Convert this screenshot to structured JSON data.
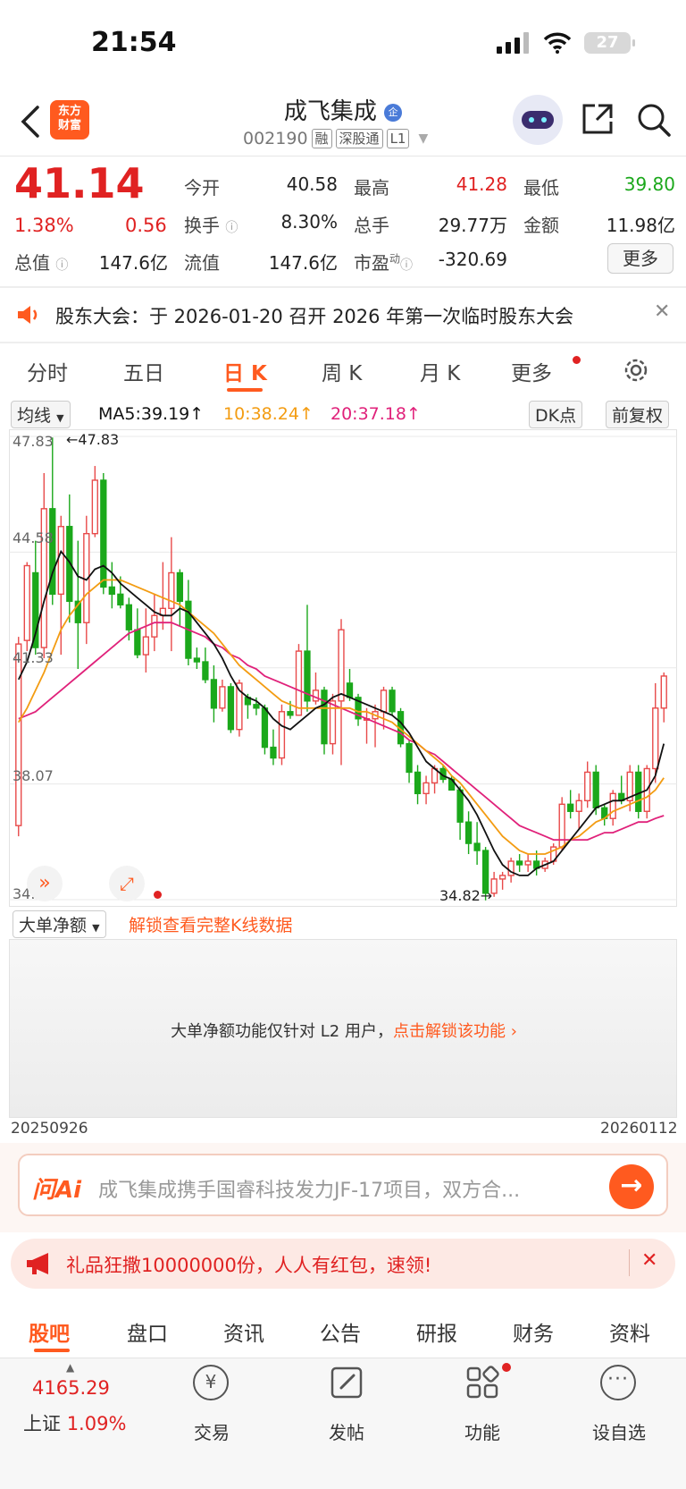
{
  "status_bar": {
    "time": "21:54",
    "battery": "27"
  },
  "header": {
    "logo_line1": "东方",
    "logo_line2": "财富",
    "stock_name": "成飞集成",
    "name_badge": "企",
    "stock_code": "002190",
    "tags": [
      "融",
      "深股通",
      "L1"
    ]
  },
  "quote": {
    "price": "41.14",
    "change_pct": "1.38%",
    "change_amt": "0.56",
    "open_label": "今开",
    "open": "40.58",
    "high_label": "最高",
    "high": "41.28",
    "low_label": "最低",
    "low": "39.80",
    "turnover_label": "换手",
    "turnover": "8.30%",
    "volume_label": "总手",
    "volume": "29.77万",
    "amount_label": "金额",
    "amount": "11.98亿",
    "mcap_label": "总值",
    "mcap": "147.6亿",
    "float_label": "流值",
    "float": "147.6亿",
    "pe_label": "市盈",
    "pe_sup": "动",
    "pe": "-320.69",
    "more_label": "更多"
  },
  "notice": {
    "text": "股东大会：于 2026-01-20 召开 2026 年第一次临时股东大会"
  },
  "chart_tabs": [
    "分时",
    "五日",
    "日 K",
    "周 K",
    "月 K",
    "更多"
  ],
  "active_chart_tab": "日 K",
  "ma_bar": {
    "indicator": "均线",
    "ma5": "MA5:39.19↑",
    "ma10": "10:38.24↑",
    "ma20": "20:37.18↑",
    "dk_label": "DK点",
    "adjust_label": "前复权",
    "ma5_color": "#111111",
    "ma10_color": "#f39c12",
    "ma20_color": "#e0217a"
  },
  "chart_data": {
    "type": "candlestick",
    "y_ticks": [
      "47.83",
      "44.58",
      "41.33",
      "38.07",
      "34.82"
    ],
    "ylim": [
      34.82,
      47.83
    ],
    "high_marker": "←47.83",
    "low_marker": "34.82→",
    "x_start": "20250926",
    "x_end": "20260112",
    "candles": [
      [
        36.9,
        42.2,
        36.6,
        42.0
      ],
      [
        42.1,
        44.3,
        41.8,
        44.2
      ],
      [
        44.0,
        44.9,
        41.7,
        41.9
      ],
      [
        41.9,
        46.8,
        41.6,
        45.8
      ],
      [
        45.8,
        47.8,
        43.1,
        43.4
      ],
      [
        43.4,
        45.6,
        41.7,
        45.3
      ],
      [
        45.3,
        46.2,
        42.6,
        43.2
      ],
      [
        43.2,
        44.9,
        41.3,
        42.6
      ],
      [
        42.6,
        45.6,
        42.0,
        45.1
      ],
      [
        45.1,
        47.0,
        45.0,
        46.6
      ],
      [
        46.6,
        46.8,
        43.4,
        43.6
      ],
      [
        43.6,
        44.3,
        43.0,
        43.4
      ],
      [
        43.4,
        43.9,
        43.0,
        43.1
      ],
      [
        43.1,
        43.3,
        42.1,
        42.4
      ],
      [
        42.4,
        43.0,
        41.6,
        41.7
      ],
      [
        41.7,
        43.0,
        41.2,
        42.2
      ],
      [
        42.2,
        43.4,
        41.8,
        42.8
      ],
      [
        42.8,
        44.3,
        42.4,
        43.0
      ],
      [
        43.0,
        45.0,
        41.8,
        44.0
      ],
      [
        44.0,
        44.1,
        42.5,
        43.2
      ],
      [
        43.2,
        43.8,
        41.4,
        41.6
      ],
      [
        41.6,
        41.9,
        41.3,
        41.5
      ],
      [
        41.5,
        41.9,
        40.9,
        41.0
      ],
      [
        41.0,
        41.4,
        39.8,
        40.2
      ],
      [
        40.2,
        41.0,
        40.1,
        40.8
      ],
      [
        40.8,
        40.9,
        39.5,
        39.6
      ],
      [
        39.6,
        41.0,
        39.4,
        40.9
      ],
      [
        40.5,
        40.6,
        39.9,
        40.3
      ],
      [
        40.3,
        40.5,
        40.0,
        40.2
      ],
      [
        40.2,
        40.3,
        38.9,
        39.1
      ],
      [
        39.1,
        39.6,
        38.6,
        38.8
      ],
      [
        38.8,
        40.3,
        38.6,
        40.1
      ],
      [
        40.1,
        40.4,
        39.9,
        40.0
      ],
      [
        40.0,
        42.0,
        40.0,
        41.8
      ],
      [
        41.8,
        43.1,
        40.1,
        40.4
      ],
      [
        40.4,
        41.2,
        40.3,
        40.7
      ],
      [
        40.7,
        40.8,
        38.9,
        39.2
      ],
      [
        39.2,
        40.6,
        38.9,
        40.4
      ],
      [
        40.4,
        42.7,
        38.6,
        42.4
      ],
      [
        40.9,
        41.3,
        40.4,
        40.5
      ],
      [
        40.5,
        40.6,
        39.7,
        39.9
      ],
      [
        39.9,
        40.2,
        39.2,
        39.9
      ],
      [
        39.9,
        40.3,
        39.1,
        40.1
      ],
      [
        40.1,
        40.8,
        39.6,
        40.7
      ],
      [
        40.7,
        40.8,
        40.0,
        40.1
      ],
      [
        40.1,
        40.2,
        39.1,
        39.2
      ],
      [
        39.2,
        39.3,
        38.1,
        38.4
      ],
      [
        38.4,
        38.6,
        37.5,
        37.8
      ],
      [
        37.8,
        38.3,
        37.5,
        38.1
      ],
      [
        38.1,
        38.6,
        37.8,
        38.5
      ],
      [
        38.5,
        38.6,
        38.1,
        38.2
      ],
      [
        38.2,
        38.3,
        37.9,
        37.9
      ],
      [
        37.9,
        38.0,
        36.5,
        37.0
      ],
      [
        37.0,
        37.3,
        36.1,
        36.4
      ],
      [
        36.4,
        37.0,
        35.8,
        36.2
      ],
      [
        36.2,
        36.3,
        34.8,
        35.0
      ],
      [
        35.0,
        35.6,
        34.9,
        35.4
      ],
      [
        35.4,
        35.6,
        35.1,
        35.5
      ],
      [
        35.5,
        36.0,
        35.3,
        35.9
      ],
      [
        35.9,
        36.1,
        35.6,
        35.8
      ],
      [
        35.8,
        36.1,
        35.6,
        35.9
      ],
      [
        35.9,
        36.2,
        35.5,
        35.7
      ],
      [
        35.7,
        36.0,
        35.6,
        35.9
      ],
      [
        35.9,
        36.4,
        35.8,
        36.3
      ],
      [
        36.3,
        37.7,
        36.2,
        37.5
      ],
      [
        37.5,
        37.9,
        37.1,
        37.3
      ],
      [
        37.3,
        37.8,
        36.8,
        37.6
      ],
      [
        37.6,
        38.7,
        37.4,
        38.4
      ],
      [
        38.4,
        38.6,
        37.2,
        37.4
      ],
      [
        37.4,
        37.5,
        36.9,
        37.1
      ],
      [
        37.1,
        37.9,
        36.9,
        37.8
      ],
      [
        37.8,
        38.3,
        37.5,
        37.6
      ],
      [
        37.6,
        38.6,
        37.3,
        38.4
      ],
      [
        38.4,
        38.6,
        37.1,
        37.3
      ],
      [
        37.3,
        38.6,
        37.1,
        38.5
      ],
      [
        38.5,
        40.9,
        38.1,
        40.2
      ],
      [
        40.2,
        41.2,
        39.8,
        41.1
      ]
    ],
    "ma5": [
      41.0,
      41.5,
      42.3,
      43.2,
      44.0,
      44.6,
      44.3,
      43.9,
      43.8,
      44.1,
      44.2,
      44.0,
      43.7,
      43.5,
      43.3,
      43.1,
      42.9,
      42.8,
      42.8,
      43.0,
      42.9,
      42.6,
      42.3,
      42.0,
      41.6,
      41.1,
      40.7,
      40.5,
      40.4,
      40.2,
      39.9,
      39.7,
      39.6,
      39.8,
      40.0,
      40.2,
      40.3,
      40.5,
      40.6,
      40.5,
      40.4,
      40.3,
      40.2,
      40.1,
      40.0,
      39.8,
      39.5,
      39.1,
      38.7,
      38.5,
      38.3,
      38.2,
      37.9,
      37.6,
      37.2,
      36.7,
      36.2,
      35.8,
      35.6,
      35.5,
      35.5,
      35.7,
      35.8,
      35.9,
      36.2,
      36.5,
      36.8,
      37.1,
      37.4,
      37.5,
      37.6,
      37.6,
      37.7,
      37.8,
      37.9,
      38.3,
      39.2
    ],
    "ma10": [
      39.8,
      40.2,
      40.7,
      41.2,
      41.8,
      42.4,
      42.8,
      43.1,
      43.4,
      43.6,
      43.8,
      43.8,
      43.8,
      43.7,
      43.6,
      43.5,
      43.4,
      43.3,
      43.2,
      43.1,
      42.9,
      42.7,
      42.5,
      42.3,
      42.0,
      41.7,
      41.4,
      41.2,
      41.0,
      40.8,
      40.6,
      40.4,
      40.3,
      40.2,
      40.2,
      40.2,
      40.2,
      40.2,
      40.2,
      40.2,
      40.1,
      40.1,
      40.0,
      39.9,
      39.8,
      39.6,
      39.4,
      39.2,
      39.0,
      38.8,
      38.6,
      38.3,
      38.1,
      37.8,
      37.5,
      37.2,
      36.9,
      36.6,
      36.4,
      36.2,
      36.1,
      36.1,
      36.1,
      36.2,
      36.3,
      36.5,
      36.6,
      36.8,
      37.0,
      37.1,
      37.3,
      37.4,
      37.5,
      37.6,
      37.7,
      37.9,
      38.24
    ],
    "ma20": [
      39.9,
      40.0,
      40.1,
      40.3,
      40.5,
      40.7,
      40.9,
      41.1,
      41.3,
      41.5,
      41.7,
      41.9,
      42.1,
      42.3,
      42.4,
      42.5,
      42.6,
      42.6,
      42.6,
      42.5,
      42.4,
      42.3,
      42.2,
      42.0,
      41.9,
      41.7,
      41.6,
      41.4,
      41.3,
      41.1,
      41.0,
      40.9,
      40.8,
      40.7,
      40.6,
      40.5,
      40.4,
      40.3,
      40.2,
      40.1,
      40.0,
      39.9,
      39.8,
      39.7,
      39.6,
      39.5,
      39.3,
      39.2,
      39.0,
      38.9,
      38.7,
      38.5,
      38.3,
      38.1,
      37.9,
      37.7,
      37.5,
      37.3,
      37.1,
      36.9,
      36.8,
      36.7,
      36.6,
      36.5,
      36.5,
      36.5,
      36.5,
      36.5,
      36.6,
      36.7,
      36.7,
      36.8,
      36.9,
      37.0,
      37.0,
      37.1,
      37.18
    ]
  },
  "volume_panel": {
    "selector": "大单净额",
    "unlock_link": "解锁查看完整K线数据",
    "l2_text": "大单净额功能仅针对 L2 用户，",
    "l2_link": "点击解锁该功能",
    "date_start": "20250926",
    "date_end": "20260112"
  },
  "ai_bar": {
    "logo": "问Ai",
    "text": "成飞集成携手国睿科技发力JF-17项目，双方合..."
  },
  "promo": {
    "text": "礼品狂撒10000000份，人人有红包，速领!"
  },
  "bottom_tabs": [
    "股吧",
    "盘口",
    "资讯",
    "公告",
    "研报",
    "财务",
    "资料"
  ],
  "dock": {
    "index_value": "4165.29",
    "index_name": "上证",
    "index_change": "1.09%",
    "items": [
      "交易",
      "发帖",
      "功能",
      "设自选"
    ]
  }
}
